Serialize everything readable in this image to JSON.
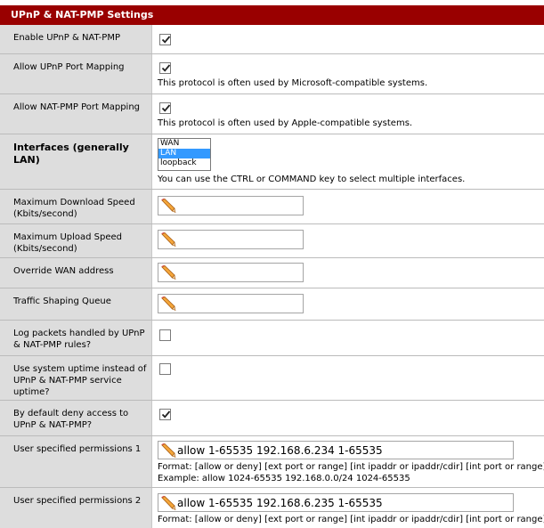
{
  "section": {
    "title": "UPnP & NAT-PMP Settings"
  },
  "colors": {
    "header_bg": "#990000",
    "label_bg": "#dddddd",
    "selected_option": "#3399ff"
  },
  "rows": {
    "enable": {
      "label": "Enable UPnP & NAT-PMP",
      "checked": true
    },
    "upnp_port_mapping": {
      "label": "Allow UPnP Port Mapping",
      "checked": true,
      "desc": "This protocol is often used by Microsoft-compatible systems."
    },
    "natpmp_port_mapping": {
      "label": "Allow NAT-PMP Port Mapping",
      "checked": true,
      "desc": "This protocol is often used by Apple-compatible systems."
    },
    "interfaces": {
      "label": "Interfaces (generally LAN)",
      "options": [
        "WAN",
        "LAN",
        "loopback"
      ],
      "selected": "LAN",
      "desc": "You can use the CTRL or COMMAND key to select multiple interfaces."
    },
    "max_download": {
      "label": "Maximum Download Speed (Kbits/second)",
      "value": ""
    },
    "max_upload": {
      "label": "Maximum Upload Speed (Kbits/second)",
      "value": ""
    },
    "override_wan": {
      "label": "Override WAN address",
      "value": ""
    },
    "shaping_queue": {
      "label": "Traffic Shaping Queue",
      "value": ""
    },
    "log_packets": {
      "label": "Log packets handled by UPnP & NAT-PMP rules?",
      "checked": false
    },
    "system_uptime": {
      "label": "Use system uptime instead of UPnP & NAT-PMP service uptime?",
      "checked": false
    },
    "default_deny": {
      "label": "By default deny access to UPnP & NAT-PMP?",
      "checked": true
    },
    "perm1": {
      "label": "User specified permissions 1",
      "value": "allow 1-65535 192.168.6.234 1-65535",
      "format": "Format: [allow or deny] [ext port or range] [int ipaddr or ipaddr/cdir] [int port or range]",
      "example": "Example: allow 1024-65535 192.168.0.0/24 1024-65535"
    },
    "perm2": {
      "label": "User specified permissions 2",
      "value": "allow 1-65535 192.168.6.235 1-65535",
      "format": "Format: [allow or deny] [ext port or range] [int ipaddr or ipaddr/cdir] [int port or range]"
    }
  },
  "icons": {
    "checkmark": "checkmark-icon",
    "pencil": "pencil-icon"
  }
}
